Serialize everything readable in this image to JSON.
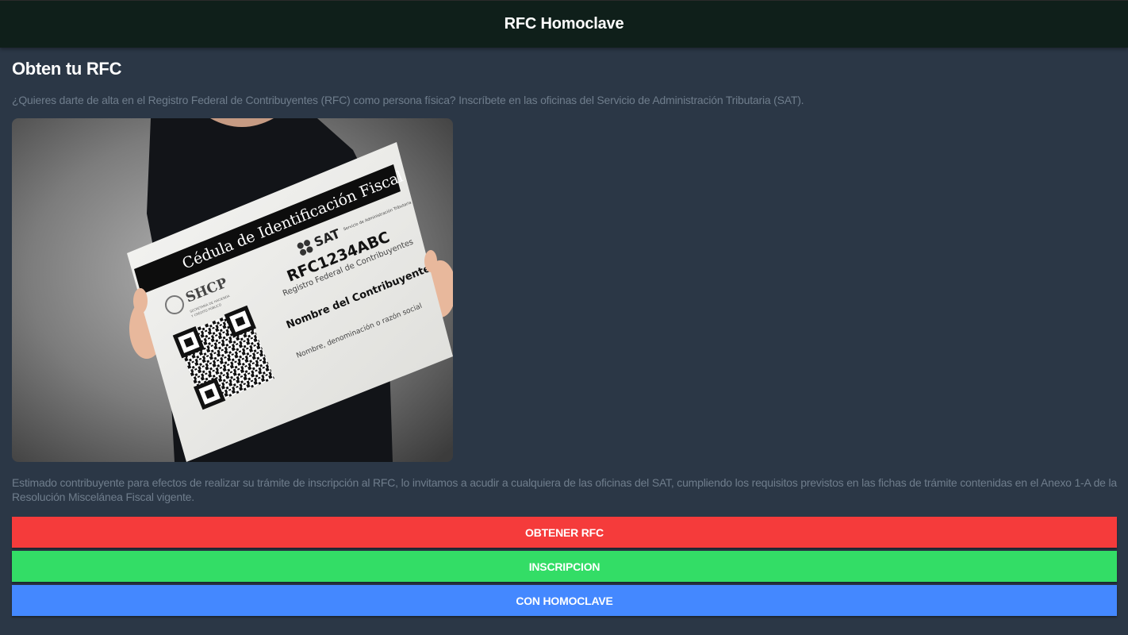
{
  "appbar": {
    "title": "RFC Homoclave"
  },
  "main": {
    "title": "Obten tu RFC",
    "intro": "¿Quieres darte de alta en el Registro Federal de Contribuyentes (RFC) como persona física? Inscríbete en las oficinas del Servicio de Administración Tributaria (SAT).",
    "body": "Estimado contribuyente para efectos de realizar su trámite de inscripción al RFC, lo invitamos a acudir a cualquiera de las oficinas del SAT, cumpliendo los requisitos previstos en las fichas de trámite contenidas en el Anexo 1-A de la Resolución Miscelánea Fiscal vigente."
  },
  "card": {
    "header": "Cédula de Identificación Fiscal",
    "sat": "SAT",
    "sat_sub": "Servicio de Administración Tributaria",
    "rfc": "RFC1234ABC",
    "rfc_sub": "Registro Federal de Contribuyentes",
    "shcp": "SHCP",
    "shcp_sub1": "SECRETARÍA DE HACIENDA",
    "shcp_sub2": "Y CRÉDITO PÚBLICO",
    "name": "Nombre del Contribuyente",
    "name_sub": "Nombre, denominación o razón social"
  },
  "buttons": {
    "obtener": "OBTENER RFC",
    "inscripcion": "INSCRIPCION",
    "homoclave": "CON HOMOCLAVE"
  },
  "colors": {
    "appbar": "#0f1f1a",
    "background": "#2b3746",
    "red": "#f53b3b",
    "green": "#33dd66",
    "blue": "#4488ff"
  }
}
